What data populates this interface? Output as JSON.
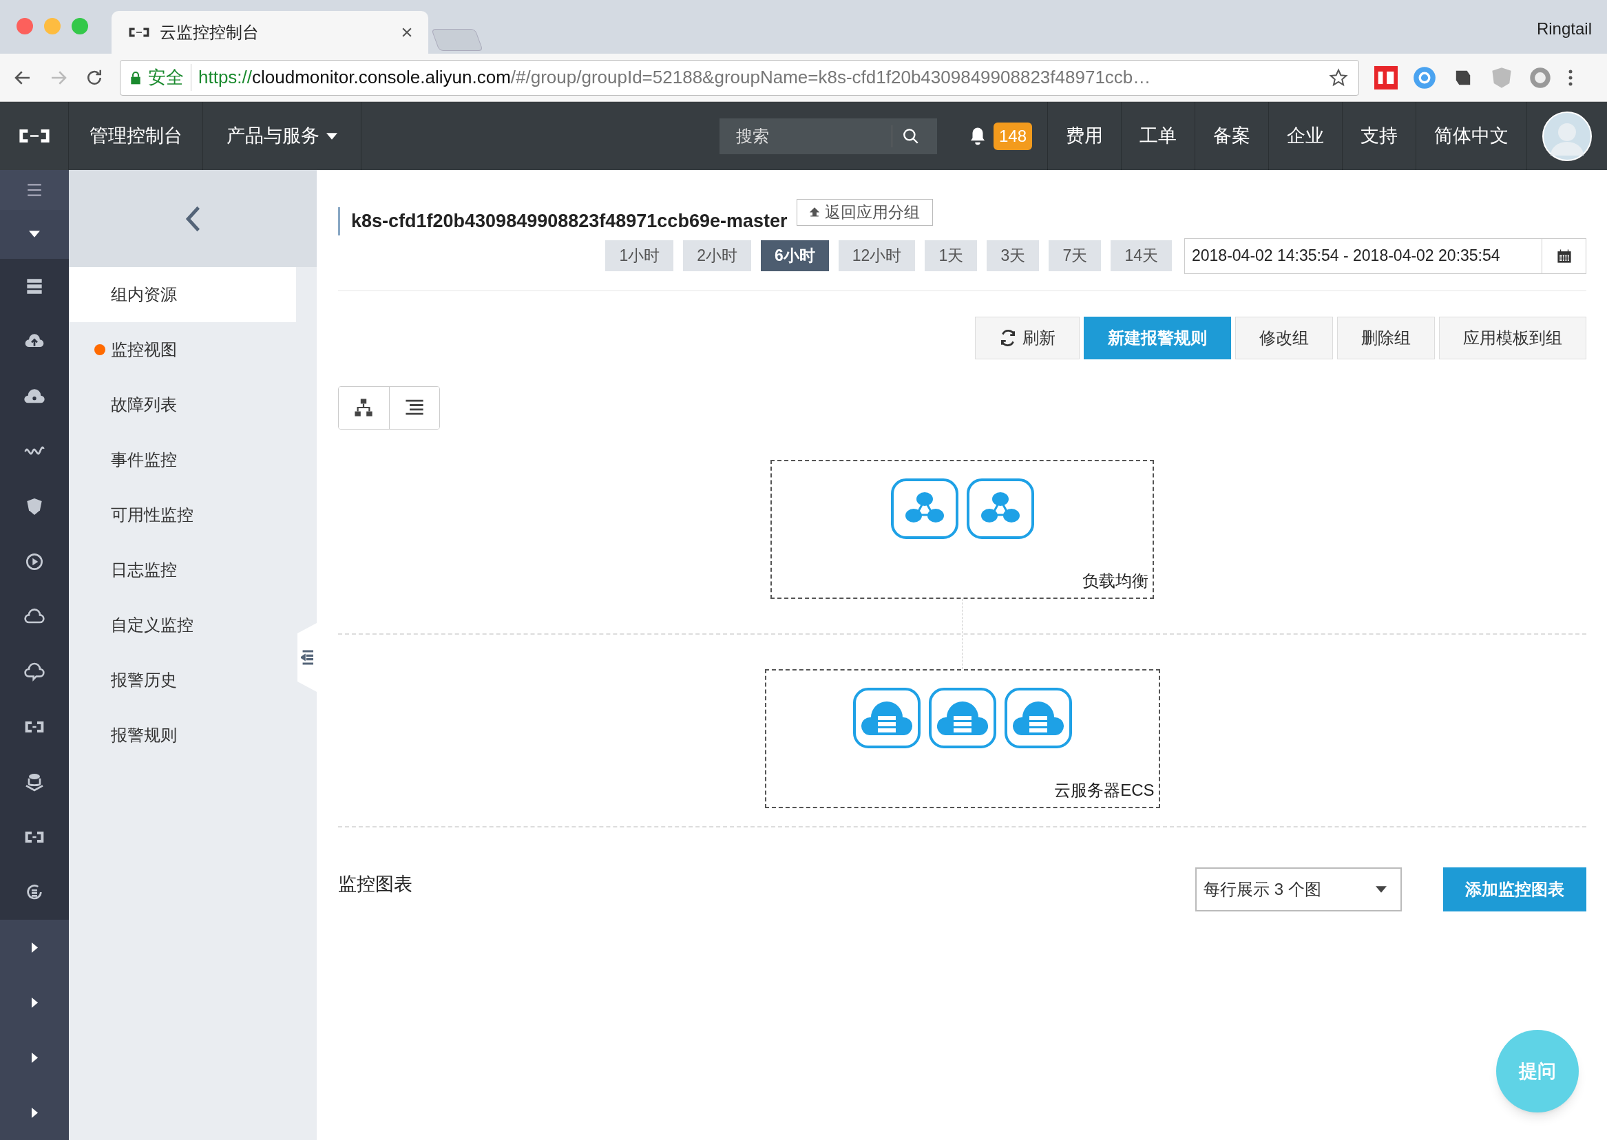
{
  "browser": {
    "tab_title": "云监控控制台",
    "profile": "Ringtail",
    "secure_label": "安全",
    "url_scheme": "https://",
    "url_host": "cloudmonitor.console.aliyun.com",
    "url_path": "/#/group/groupId=52188&groupName=k8s-cfd1f20b4309849908823f48971ccb…"
  },
  "topnav": {
    "console": "管理控制台",
    "products": "产品与服务",
    "search": {
      "placeholder": "搜索"
    },
    "notification_count": "148",
    "links": [
      "费用",
      "工单",
      "备案",
      "企业",
      "支持",
      "简体中文"
    ]
  },
  "submenu": {
    "items": [
      {
        "label": "组内资源",
        "selected": true,
        "dot": false
      },
      {
        "label": "监控视图",
        "selected": false,
        "dot": true
      },
      {
        "label": "故障列表",
        "selected": false,
        "dot": false
      },
      {
        "label": "事件监控",
        "selected": false,
        "dot": false
      },
      {
        "label": "可用性监控",
        "selected": false,
        "dot": false
      },
      {
        "label": "日志监控",
        "selected": false,
        "dot": false
      },
      {
        "label": "自定义监控",
        "selected": false,
        "dot": false
      },
      {
        "label": "报警历史",
        "selected": false,
        "dot": false
      },
      {
        "label": "报警规则",
        "selected": false,
        "dot": false
      }
    ]
  },
  "group": {
    "title": "k8s-cfd1f20b4309849908823f48971ccb69e-master",
    "back_button": "返回应用分组",
    "time_ranges": [
      {
        "label": "1小时",
        "selected": false
      },
      {
        "label": "2小时",
        "selected": false
      },
      {
        "label": "6小时",
        "selected": true
      },
      {
        "label": "12小时",
        "selected": false
      },
      {
        "label": "1天",
        "selected": false
      },
      {
        "label": "3天",
        "selected": false
      },
      {
        "label": "7天",
        "selected": false
      },
      {
        "label": "14天",
        "selected": false
      }
    ],
    "date_range": "2018-04-02 14:35:54 - 2018-04-02 20:35:54",
    "actions": [
      {
        "label": "刷新",
        "kind": "refresh"
      },
      {
        "label": "新建报警规则",
        "kind": "primary"
      },
      {
        "label": "修改组",
        "kind": "default"
      },
      {
        "label": "删除组",
        "kind": "default"
      },
      {
        "label": "应用模板到组",
        "kind": "default"
      }
    ]
  },
  "topology": {
    "layers": [
      {
        "label": "负载均衡",
        "nodes": [
          {
            "kind": "load-balancer"
          },
          {
            "kind": "load-balancer"
          }
        ]
      },
      {
        "label": "云服务器ECS",
        "nodes": [
          {
            "kind": "cloud-server"
          },
          {
            "kind": "cloud-server"
          },
          {
            "kind": "cloud-server"
          }
        ]
      }
    ]
  },
  "charts": {
    "title": "监控图表",
    "per_row_select": "每行展示 3 个图",
    "add_button": "添加监控图表"
  },
  "help_button": "提问"
}
